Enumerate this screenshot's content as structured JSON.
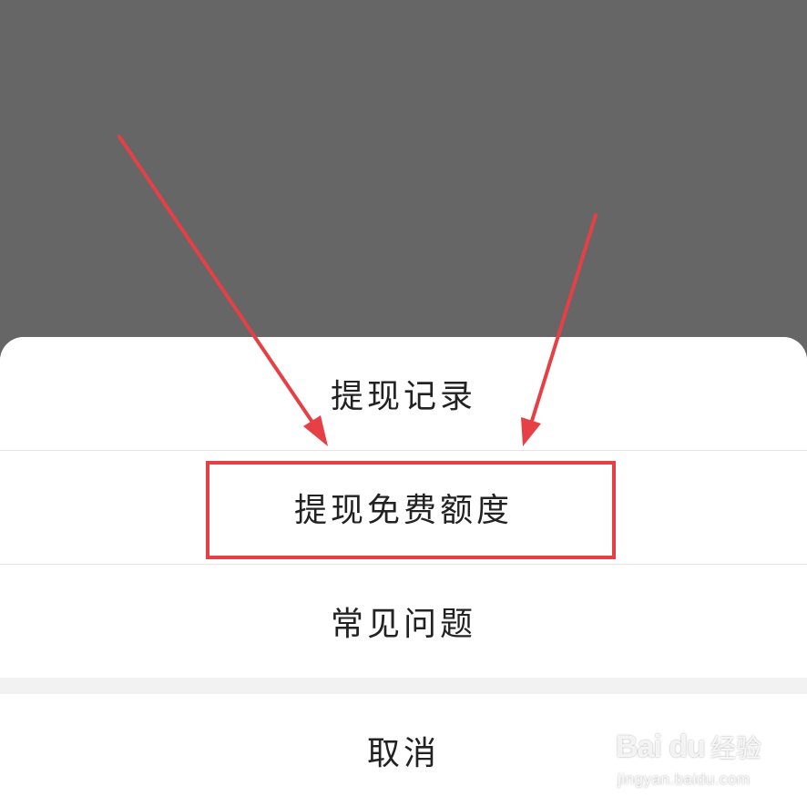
{
  "action_sheet": {
    "items": [
      {
        "label": "提现记录"
      },
      {
        "label": "提现免费额度"
      },
      {
        "label": "常见问题"
      }
    ],
    "cancel_label": "取消"
  },
  "annotation": {
    "highlight_color": "#e54046",
    "highlighted_item": "提现免费额度"
  },
  "watermark": {
    "brand": "Bai du",
    "sub": "经验",
    "url": "jingyan.baidu.com"
  }
}
